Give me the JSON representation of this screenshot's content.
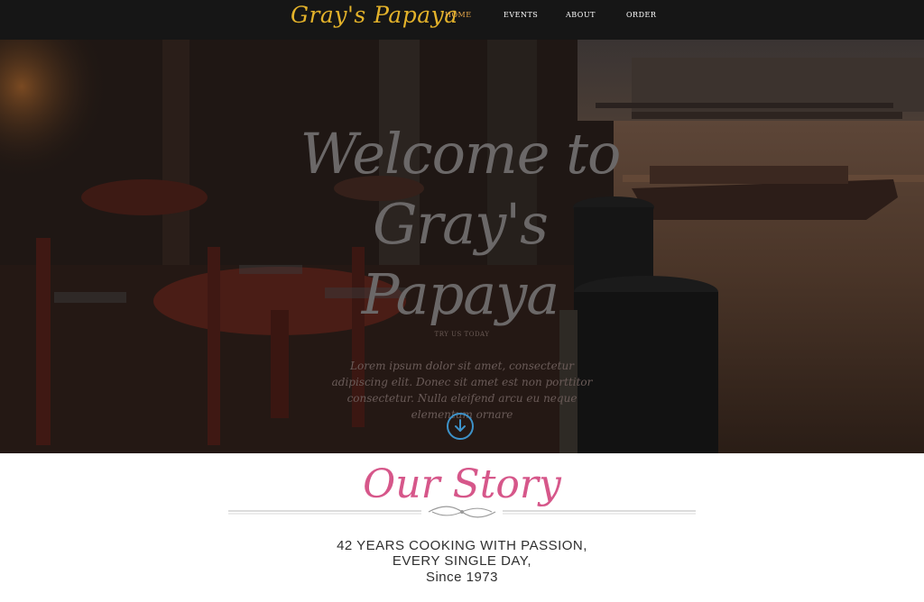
{
  "header": {
    "brand": "Gray's Papaya",
    "nav": {
      "home": "HOME",
      "events": "EVENTS",
      "about": "ABOUT",
      "order": "ORDER"
    }
  },
  "hero": {
    "title_line1": "Welcome to Gray's",
    "title_line2": "Papaya",
    "kicker": "TRY US TODAY",
    "text": "Lorem ipsum dolor sit amet, consectetur adipiscing elit. Donec sit amet est non porttitor consectetur. Nulla eleifend arcu eu neque elementum ornare",
    "scroll_icon": "arrow-down-circle-icon"
  },
  "story": {
    "heading": "Our Story",
    "line1": "42 YEARS COOKING WITH PASSION,",
    "line2": "EVERY SINGLE DAY,",
    "line3": "Since 1973"
  },
  "colors": {
    "brand_gold": "#e3b22a",
    "nav_active": "#e7a84a",
    "story_pink": "#d6578a",
    "scroll_blue": "#3d92c9"
  }
}
